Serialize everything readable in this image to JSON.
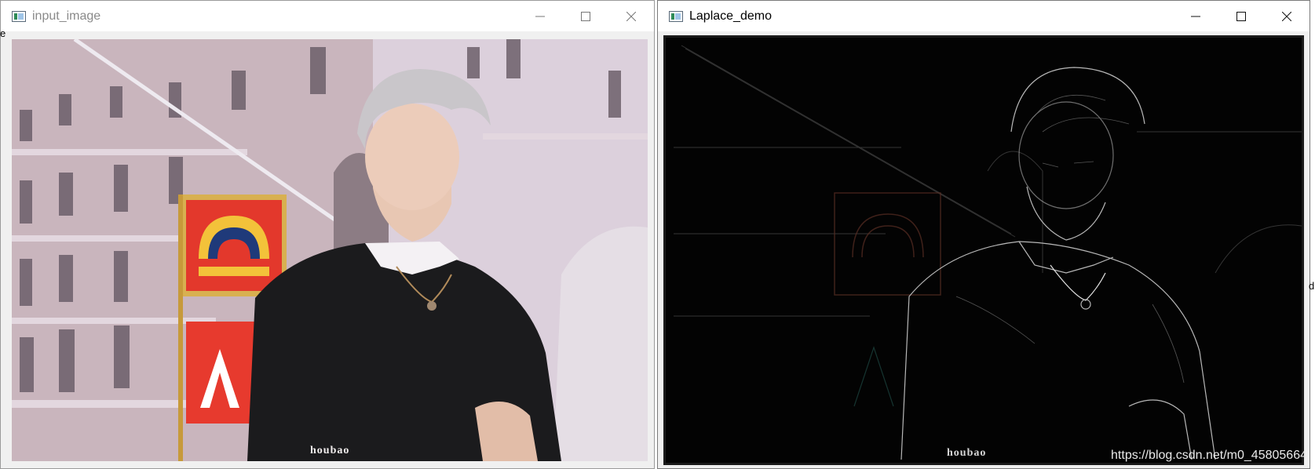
{
  "windows": [
    {
      "title": "input_image",
      "icon": "opencv-window-icon",
      "controls": {
        "minimize": "minimize-icon",
        "maximize": "maximize-icon",
        "close": "close-icon"
      },
      "image": {
        "description_icon": "photo",
        "watermark": "houbao"
      },
      "active": false
    },
    {
      "title": "Laplace_demo",
      "icon": "opencv-window-icon",
      "controls": {
        "minimize": "minimize-icon",
        "maximize": "maximize-icon",
        "close": "close-icon"
      },
      "image": {
        "watermark": "houbao"
      },
      "active": true
    }
  ],
  "edge_glyphs": {
    "left": "e",
    "right": "d"
  },
  "page_watermark": "https://blog.csdn.net/m0_45805664",
  "colors": {
    "inactive_title": "#8a8a8a",
    "active_title": "#000000",
    "laplace_bg": "#030303"
  }
}
